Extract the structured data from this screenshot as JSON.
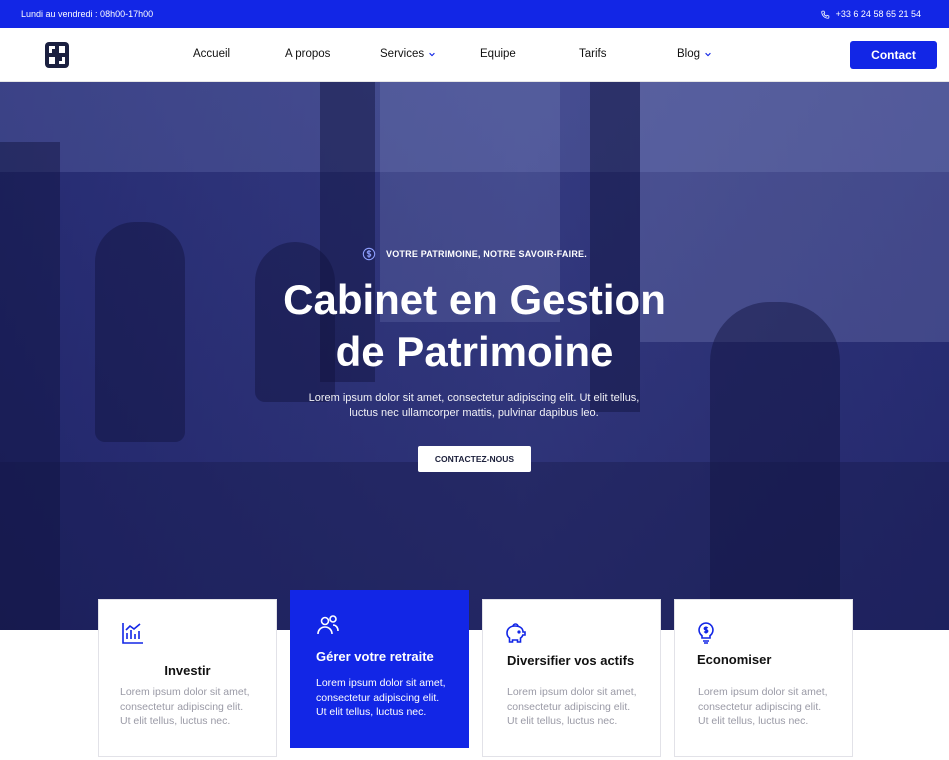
{
  "topbar": {
    "hours": "Lundi au vendredi : 08h00-17h00",
    "phone": "+33 6 24 58 65 21 54"
  },
  "nav": {
    "items": [
      {
        "label": "Accueil",
        "dropdown": false
      },
      {
        "label": "A propos",
        "dropdown": false
      },
      {
        "label": "Services",
        "dropdown": true
      },
      {
        "label": "Equipe",
        "dropdown": false
      },
      {
        "label": "Tarifs",
        "dropdown": false
      },
      {
        "label": "Blog",
        "dropdown": true
      }
    ],
    "contact_label": "Contact"
  },
  "hero": {
    "eyebrow": "VOTRE PATRIMOINE, NOTRE SAVOIR-FAIRE.",
    "title_line1": "Cabinet en Gestion",
    "title_line2": "de Patrimoine",
    "text_line1": "Lorem ipsum dolor sit amet, consectetur adipiscing elit. Ut elit tellus,",
    "text_line2": "luctus nec ullamcorper mattis, pulvinar dapibus leo.",
    "cta_label": "CONTACTEZ-NOUS"
  },
  "cards": [
    {
      "title": "Investir",
      "icon": "chart-icon",
      "lines": [
        "Lorem ipsum dolor sit amet,",
        "consectetur adipiscing elit.",
        "Ut elit tellus, luctus nec."
      ],
      "active": false
    },
    {
      "title": "Gérer votre retraite",
      "icon": "users-icon",
      "lines": [
        "Lorem ipsum dolor sit amet,",
        "consectetur adipiscing elit.",
        "Ut elit tellus, luctus nec."
      ],
      "active": true
    },
    {
      "title": "Diversifier vos actifs",
      "icon": "piggy-bank-icon",
      "lines": [
        "Lorem ipsum dolor sit amet,",
        "consectetur adipiscing elit.",
        "Ut elit tellus, luctus nec."
      ],
      "active": false
    },
    {
      "title": "Economiser",
      "icon": "lightbulb-dollar-icon",
      "lines": [
        "Lorem ipsum dolor sit amet,",
        "consectetur adipiscing elit.",
        "Ut elit tellus, luctus nec."
      ],
      "active": false
    }
  ],
  "colors": {
    "brand": "#1226e6",
    "hero_overlay": "#262c78",
    "muted_text": "#9a9aa6"
  }
}
